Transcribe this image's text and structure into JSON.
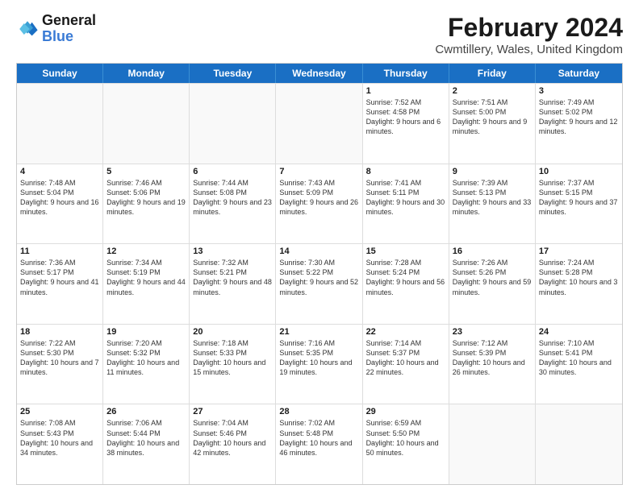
{
  "header": {
    "logo_line1": "General",
    "logo_line2": "Blue",
    "main_title": "February 2024",
    "subtitle": "Cwmtillery, Wales, United Kingdom"
  },
  "calendar": {
    "days_of_week": [
      "Sunday",
      "Monday",
      "Tuesday",
      "Wednesday",
      "Thursday",
      "Friday",
      "Saturday"
    ],
    "rows": [
      [
        {
          "day": "",
          "info": ""
        },
        {
          "day": "",
          "info": ""
        },
        {
          "day": "",
          "info": ""
        },
        {
          "day": "",
          "info": ""
        },
        {
          "day": "1",
          "info": "Sunrise: 7:52 AM\nSunset: 4:58 PM\nDaylight: 9 hours and 6 minutes."
        },
        {
          "day": "2",
          "info": "Sunrise: 7:51 AM\nSunset: 5:00 PM\nDaylight: 9 hours and 9 minutes."
        },
        {
          "day": "3",
          "info": "Sunrise: 7:49 AM\nSunset: 5:02 PM\nDaylight: 9 hours and 12 minutes."
        }
      ],
      [
        {
          "day": "4",
          "info": "Sunrise: 7:48 AM\nSunset: 5:04 PM\nDaylight: 9 hours and 16 minutes."
        },
        {
          "day": "5",
          "info": "Sunrise: 7:46 AM\nSunset: 5:06 PM\nDaylight: 9 hours and 19 minutes."
        },
        {
          "day": "6",
          "info": "Sunrise: 7:44 AM\nSunset: 5:08 PM\nDaylight: 9 hours and 23 minutes."
        },
        {
          "day": "7",
          "info": "Sunrise: 7:43 AM\nSunset: 5:09 PM\nDaylight: 9 hours and 26 minutes."
        },
        {
          "day": "8",
          "info": "Sunrise: 7:41 AM\nSunset: 5:11 PM\nDaylight: 9 hours and 30 minutes."
        },
        {
          "day": "9",
          "info": "Sunrise: 7:39 AM\nSunset: 5:13 PM\nDaylight: 9 hours and 33 minutes."
        },
        {
          "day": "10",
          "info": "Sunrise: 7:37 AM\nSunset: 5:15 PM\nDaylight: 9 hours and 37 minutes."
        }
      ],
      [
        {
          "day": "11",
          "info": "Sunrise: 7:36 AM\nSunset: 5:17 PM\nDaylight: 9 hours and 41 minutes."
        },
        {
          "day": "12",
          "info": "Sunrise: 7:34 AM\nSunset: 5:19 PM\nDaylight: 9 hours and 44 minutes."
        },
        {
          "day": "13",
          "info": "Sunrise: 7:32 AM\nSunset: 5:21 PM\nDaylight: 9 hours and 48 minutes."
        },
        {
          "day": "14",
          "info": "Sunrise: 7:30 AM\nSunset: 5:22 PM\nDaylight: 9 hours and 52 minutes."
        },
        {
          "day": "15",
          "info": "Sunrise: 7:28 AM\nSunset: 5:24 PM\nDaylight: 9 hours and 56 minutes."
        },
        {
          "day": "16",
          "info": "Sunrise: 7:26 AM\nSunset: 5:26 PM\nDaylight: 9 hours and 59 minutes."
        },
        {
          "day": "17",
          "info": "Sunrise: 7:24 AM\nSunset: 5:28 PM\nDaylight: 10 hours and 3 minutes."
        }
      ],
      [
        {
          "day": "18",
          "info": "Sunrise: 7:22 AM\nSunset: 5:30 PM\nDaylight: 10 hours and 7 minutes."
        },
        {
          "day": "19",
          "info": "Sunrise: 7:20 AM\nSunset: 5:32 PM\nDaylight: 10 hours and 11 minutes."
        },
        {
          "day": "20",
          "info": "Sunrise: 7:18 AM\nSunset: 5:33 PM\nDaylight: 10 hours and 15 minutes."
        },
        {
          "day": "21",
          "info": "Sunrise: 7:16 AM\nSunset: 5:35 PM\nDaylight: 10 hours and 19 minutes."
        },
        {
          "day": "22",
          "info": "Sunrise: 7:14 AM\nSunset: 5:37 PM\nDaylight: 10 hours and 22 minutes."
        },
        {
          "day": "23",
          "info": "Sunrise: 7:12 AM\nSunset: 5:39 PM\nDaylight: 10 hours and 26 minutes."
        },
        {
          "day": "24",
          "info": "Sunrise: 7:10 AM\nSunset: 5:41 PM\nDaylight: 10 hours and 30 minutes."
        }
      ],
      [
        {
          "day": "25",
          "info": "Sunrise: 7:08 AM\nSunset: 5:43 PM\nDaylight: 10 hours and 34 minutes."
        },
        {
          "day": "26",
          "info": "Sunrise: 7:06 AM\nSunset: 5:44 PM\nDaylight: 10 hours and 38 minutes."
        },
        {
          "day": "27",
          "info": "Sunrise: 7:04 AM\nSunset: 5:46 PM\nDaylight: 10 hours and 42 minutes."
        },
        {
          "day": "28",
          "info": "Sunrise: 7:02 AM\nSunset: 5:48 PM\nDaylight: 10 hours and 46 minutes."
        },
        {
          "day": "29",
          "info": "Sunrise: 6:59 AM\nSunset: 5:50 PM\nDaylight: 10 hours and 50 minutes."
        },
        {
          "day": "",
          "info": ""
        },
        {
          "day": "",
          "info": ""
        }
      ]
    ]
  }
}
